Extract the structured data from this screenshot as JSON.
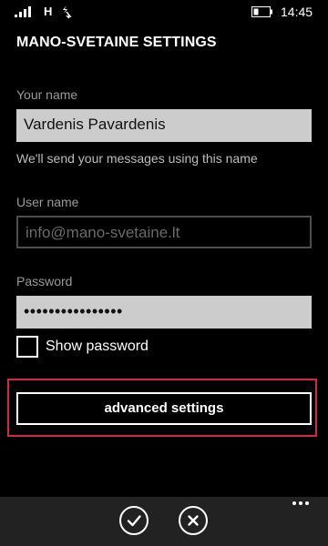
{
  "status_bar": {
    "network_type": "H",
    "time": "14:45",
    "signal_icon": "signal-strength-icon",
    "data_icon": "data-transfer-icon",
    "battery_icon": "battery-icon"
  },
  "page": {
    "title": "MANO-SVETAINE SETTINGS"
  },
  "form": {
    "your_name": {
      "label": "Your name",
      "value": "Vardenis Pavardenis",
      "hint": "We'll send your messages using this name"
    },
    "user_name": {
      "label": "User name",
      "value": "info@mano-svetaine.lt"
    },
    "password": {
      "label": "Password",
      "value": "••••••••••••••••"
    },
    "show_password": {
      "label": "Show password",
      "checked": false
    },
    "advanced_button": {
      "label": "advanced settings"
    }
  },
  "app_bar": {
    "confirm_icon": "checkmark-icon",
    "cancel_icon": "close-icon",
    "more_icon": "more-options-icon"
  },
  "colors": {
    "background": "#000000",
    "field_fill": "#cccccc",
    "highlight": "#d6244a",
    "app_bar": "#222222",
    "label": "#9a9a9a"
  }
}
